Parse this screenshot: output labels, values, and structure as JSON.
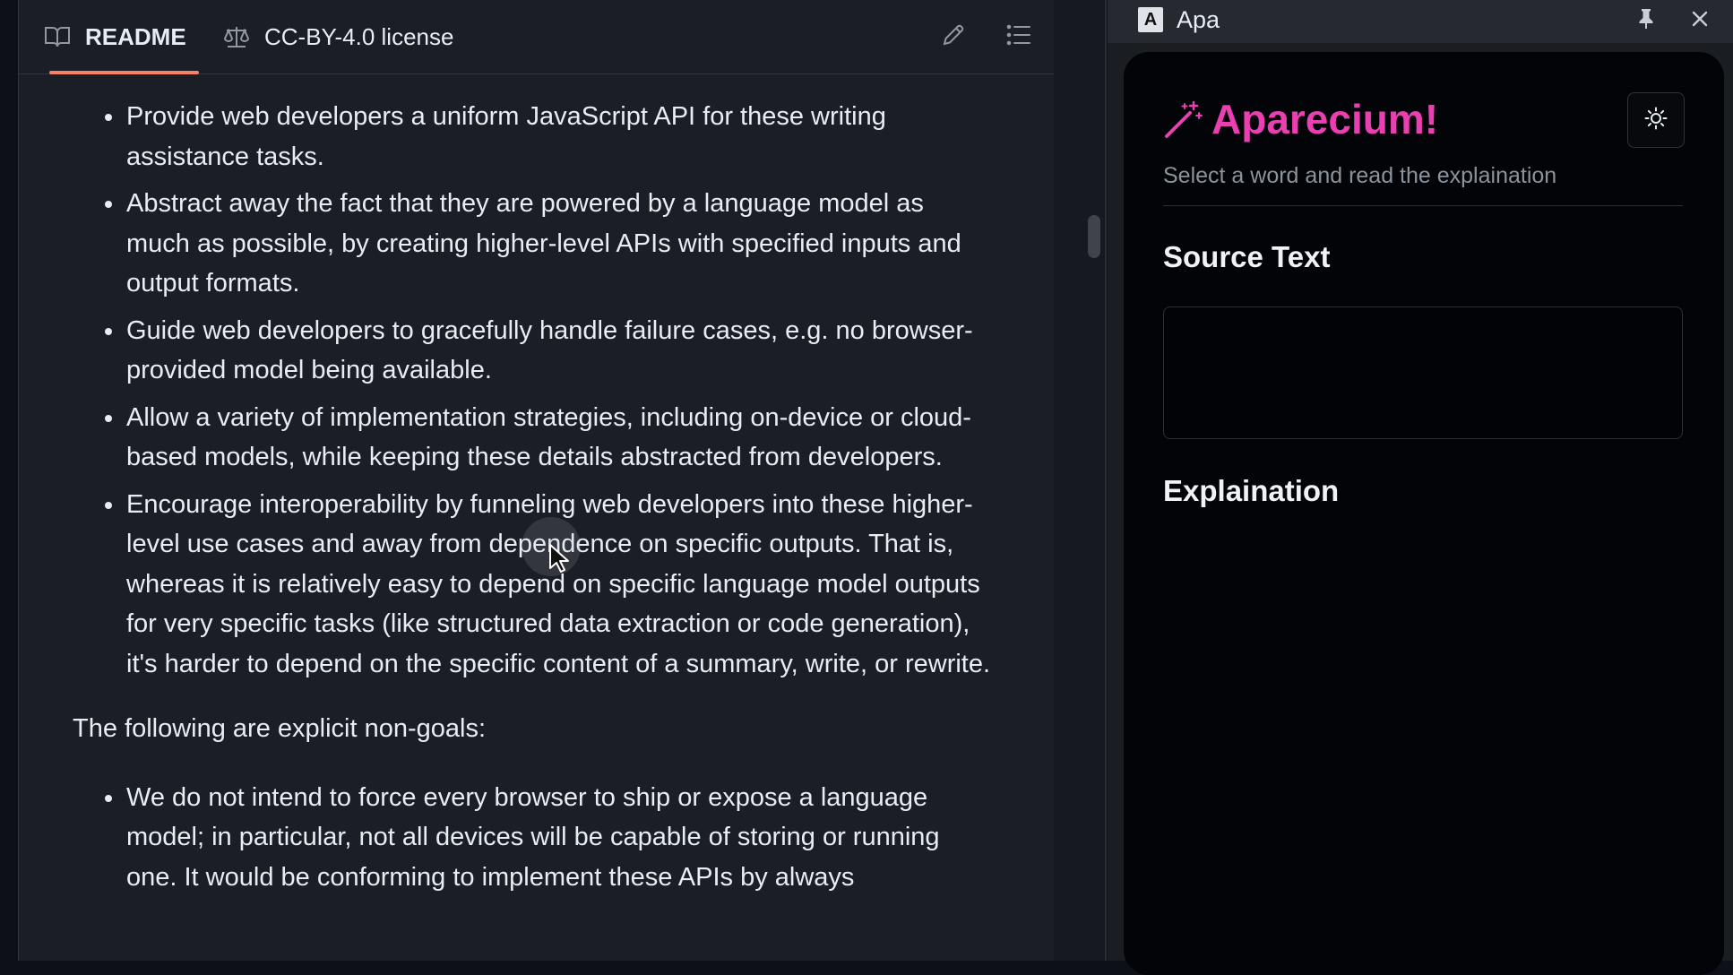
{
  "readme": {
    "tabs": [
      {
        "label": "README",
        "icon": "book-icon"
      },
      {
        "label": "CC-BY-4.0 license",
        "icon": "scale-icon"
      }
    ],
    "goals": [
      "Provide web developers a uniform JavaScript API for these writing assistance tasks.",
      "Abstract away the fact that they are powered by a language model as much as possible, by creating higher-level APIs with specified inputs and output formats.",
      "Guide web developers to gracefully handle failure cases, e.g. no browser-provided model being available.",
      "Allow a variety of implementation strategies, including on-device or cloud-based models, while keeping these details abstracted from developers.",
      "Encourage interoperability by funneling web developers into these higher-level use cases and away from dependence on specific outputs. That is, whereas it is relatively easy to depend on specific language model outputs for very specific tasks (like structured data extraction or code generation), it's harder to depend on the specific content of a summary, write, or rewrite."
    ],
    "nongoals_intro": "The following are explicit non-goals:",
    "nongoals": [
      "We do not intend to force every browser to ship or expose a language model; in particular, not all devices will be capable of storing or running one. It would be conforming to implement these APIs by always"
    ],
    "accent_color": "#f78166"
  },
  "apa_window": {
    "app_icon_letter": "A",
    "title": "Apa",
    "heading": "Aparecium!",
    "subtitle": "Select a word and read the explaination",
    "source_heading": "Source Text",
    "source_text": "",
    "explanation_heading": "Explaination",
    "accent_color": "#e93fb0"
  }
}
